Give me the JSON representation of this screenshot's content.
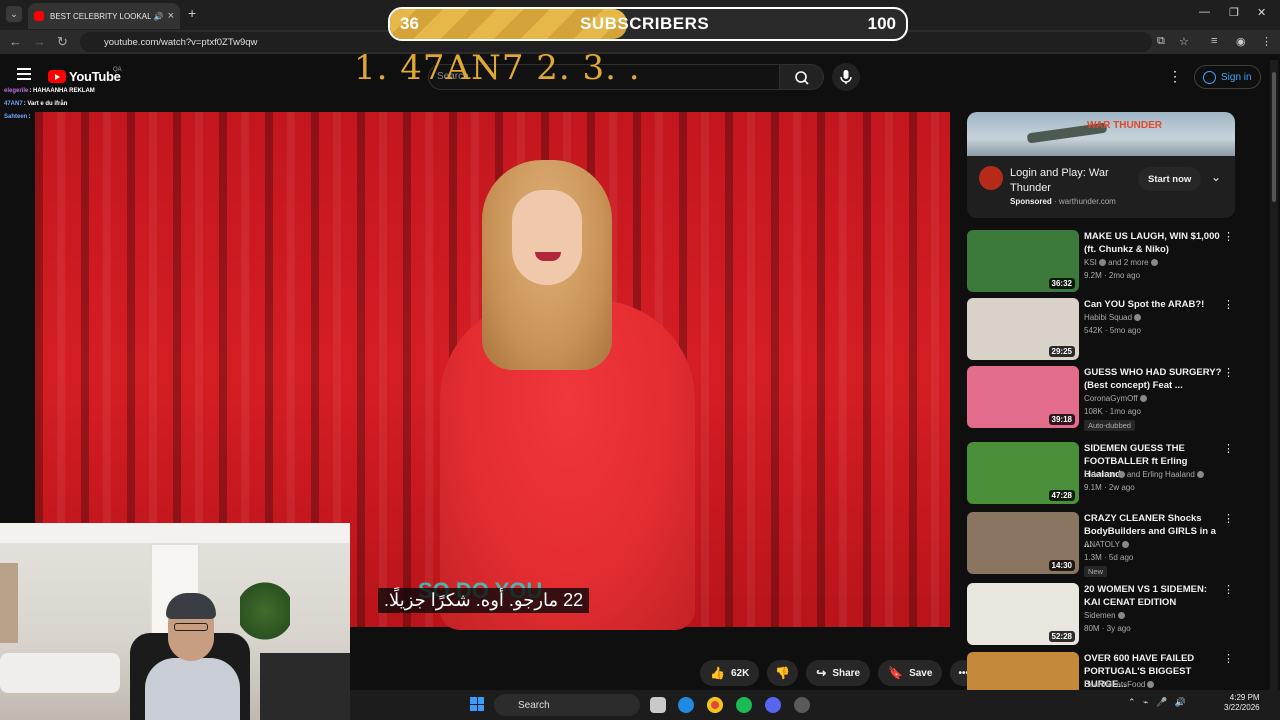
{
  "browser": {
    "tab_title": "BEST CELEBRITY LOOKALIKE",
    "tab_close": "×",
    "new_tab": "+",
    "url": "youtube.com/watch?v=ptxf0ZTw9qw"
  },
  "goal": {
    "current": "36",
    "label": "SUBSCRIBERS",
    "max": "100",
    "progress_fraction": 0.36
  },
  "overlay_text": "1. 47AN7   2.  3.  .",
  "youtube": {
    "logo": "YouTube",
    "country": "QA",
    "search_placeholder": "Search",
    "sign_in": "Sign in"
  },
  "chat": [
    {
      "user": "elegerile",
      "msg": "HAHAANHA REKLAM",
      "color": "#c06ce0"
    },
    {
      "user": "47AN7",
      "msg": "Vart e du ifrån",
      "color": "#6ea8ff"
    },
    {
      "user": "Sahteen",
      "msg": "",
      "color": "#6ea8ff"
    }
  ],
  "video": {
    "subtitle_ghost": "SO DO YOU",
    "subtitle": "22 مارجو. أوه. شكرًا جزيلًا."
  },
  "actions": {
    "likes": "62K",
    "share": "Share",
    "save": "Save"
  },
  "ad": {
    "title": "Login and Play: War Thunder",
    "sponsored": "Sponsored",
    "domain": "warthunder.com",
    "cta": "Start now",
    "banner_logo": "WAR THUNDER"
  },
  "recommendations": [
    {
      "title": "MAKE US LAUGH, WIN $1,000 (ft. Chunkz & Niko)",
      "channel": "KSI",
      "channel_extra": "and 2 more",
      "meta": "9.2M · 2mo ago",
      "duration": "36:32",
      "badge": "",
      "thumb": "#3b7a3a"
    },
    {
      "title": "Can YOU Spot the ARAB?!",
      "channel": "Habibi Squad",
      "channel_extra": "",
      "meta": "542K · 5mo ago",
      "duration": "29:25",
      "badge": "",
      "thumb": "#d8d2c8"
    },
    {
      "title": "GUESS WHO HAD SURGERY? (Best concept) Feat ...",
      "channel": "CoronaGymOff",
      "channel_extra": "",
      "meta": "108K · 1mo ago",
      "duration": "39:18",
      "badge": "Auto-dubbed",
      "thumb": "#e46d8d"
    },
    {
      "title": "SIDEMEN GUESS THE FOOTBALLER ft Erling Haaland",
      "channel": "Sidemen",
      "channel_extra": "and Erling Haaland",
      "meta": "9.1M · 2w ago",
      "duration": "47:28",
      "badge": "",
      "thumb": "#4a8f3a"
    },
    {
      "title": "CRAZY CLEANER Shocks BodyBuilders and GIRLS in a ...",
      "channel": "ANATOLY",
      "channel_extra": "",
      "meta": "1.3M · 5d ago",
      "duration": "14:30",
      "badge": "New",
      "thumb": "#8a7560"
    },
    {
      "title": "20 WOMEN VS 1 SIDEMEN: KAI CENAT EDITION",
      "channel": "Sidemen",
      "channel_extra": "",
      "meta": "80M · 3y ago",
      "duration": "52:28",
      "badge": "",
      "thumb": "#e9e6e0"
    },
    {
      "title": "OVER 600 HAVE FAILED PORTUGAL'S BIGGEST BURGE...",
      "channel": "BeardMeatsFood",
      "channel_extra": "",
      "meta": "",
      "duration": "",
      "badge": "",
      "thumb": "#c48a3a"
    }
  ],
  "taskbar": {
    "search": "Search",
    "time": "4:29 PM",
    "date": "3/22/2026"
  }
}
